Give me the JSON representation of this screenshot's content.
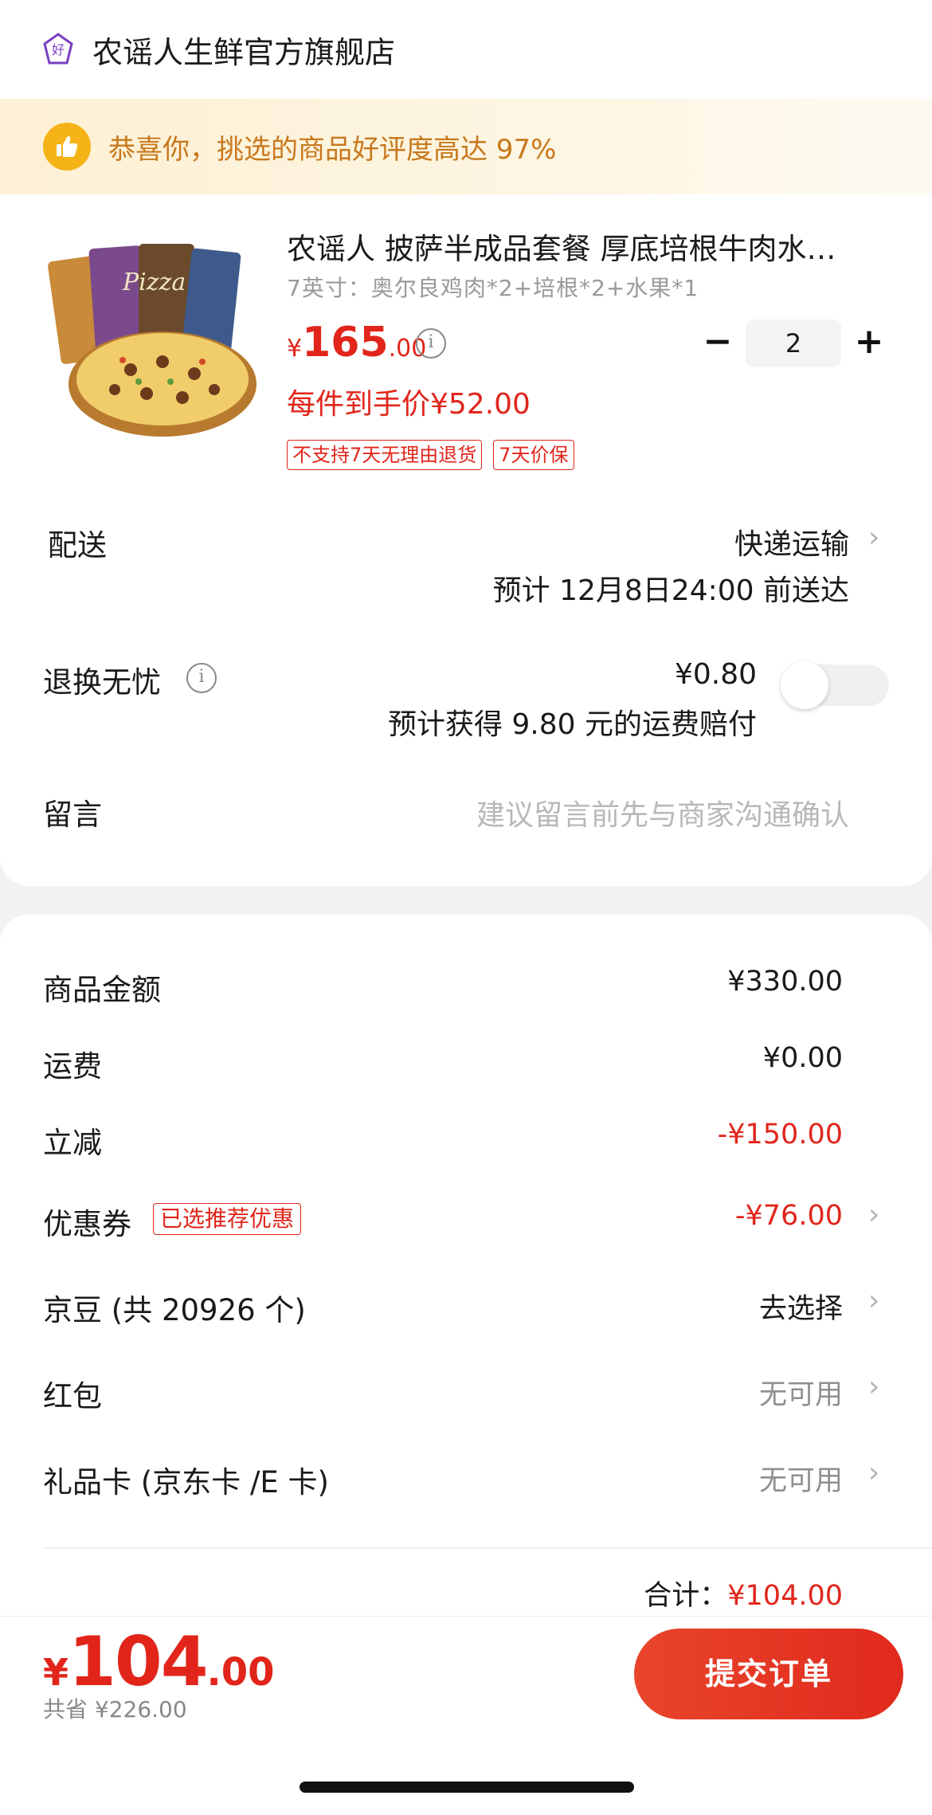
{
  "shop": {
    "icon": "shop-badge-icon",
    "icon_glyph": "好",
    "name": "农谣人生鲜官方旗舰店"
  },
  "banner": {
    "icon": "thumbs-up-icon",
    "text": "恭喜你，挑选的商品好评度高达 97%"
  },
  "product": {
    "image": "pizza-product-image",
    "title": "农谣人 披萨半成品套餐 厚底培根牛肉水…",
    "spec": "7英寸：奥尔良鸡肉*2+培根*2+水果*1",
    "price_currency": "¥",
    "price_int": "165",
    "price_dec": ".00",
    "unit_price": "每件到手价¥52.00",
    "tags": [
      "不支持7天无理由退货",
      "7天价保"
    ],
    "quantity": "2",
    "minus": "−",
    "plus": "+"
  },
  "delivery": {
    "label": "配送",
    "method": "快递运输",
    "eta": "预计 12月8日24:00 前送达"
  },
  "returns": {
    "label": "退换无忧",
    "price": "¥0.80",
    "note": "预计获得 9.80 元的运费赔付",
    "enabled": false
  },
  "message": {
    "label": "留言",
    "placeholder": "建议留言前先与商家沟通确认"
  },
  "summary": {
    "goods": {
      "label": "商品金额",
      "value": "¥330.00"
    },
    "shipping": {
      "label": "运费",
      "value": "¥0.00"
    },
    "discount": {
      "label": "立减",
      "value": "-¥150.00"
    },
    "coupon": {
      "label": "优惠券",
      "tag": "已选推荐优惠",
      "value": "-¥76.00"
    },
    "jingdou": {
      "label": "京豆 (共 20926 个)",
      "value": "去选择"
    },
    "redpacket": {
      "label": "红包",
      "value": "无可用"
    },
    "giftcard": {
      "label": "礼品卡 (京东卡 /E 卡)",
      "value": "无可用"
    },
    "total_label": "合计：",
    "total_value": "¥104.00"
  },
  "footer": {
    "currency": "¥",
    "price_int": "104",
    "price_dec": ".00",
    "saved": "共省 ¥226.00",
    "submit": "提交订单"
  },
  "colors": {
    "accent": "#e1251b",
    "banner_text": "#c8781c",
    "thumb": "#f5b317"
  }
}
